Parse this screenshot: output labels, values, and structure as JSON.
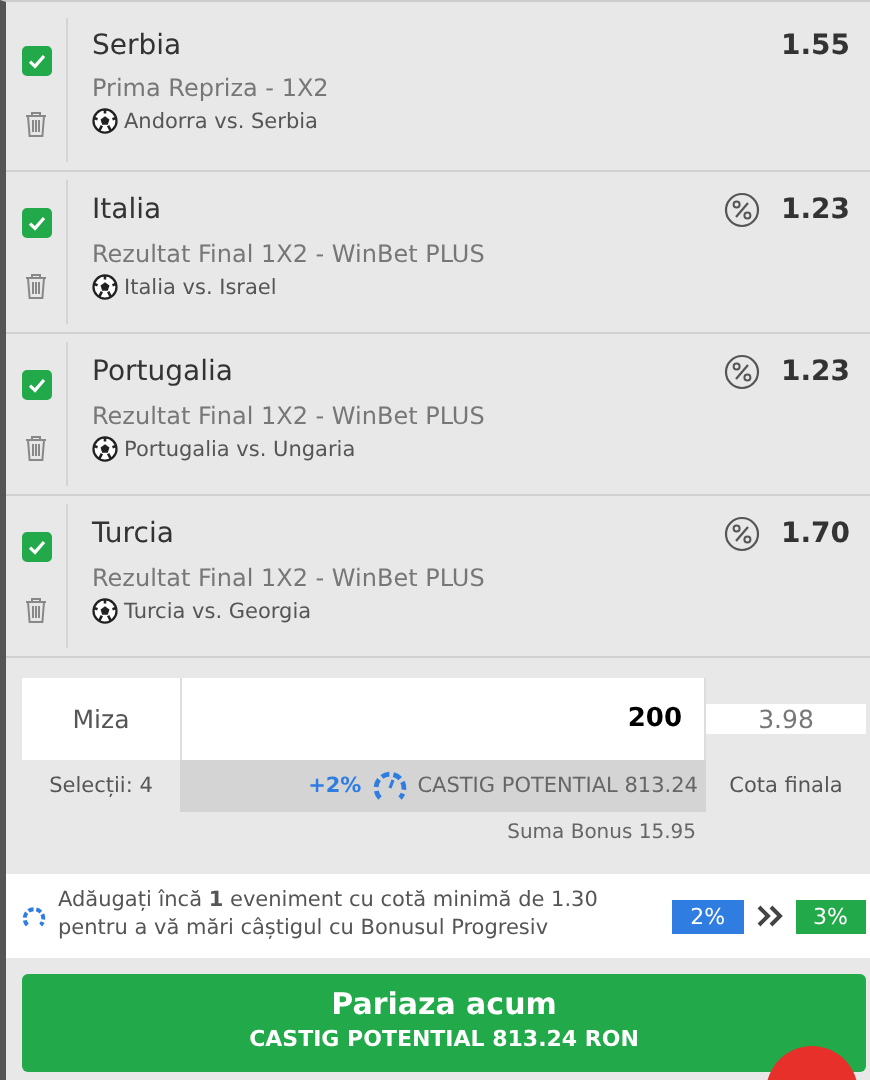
{
  "bets": [
    {
      "checked": true,
      "team": "Serbia",
      "market": "Prima Repriza - 1X2",
      "match": "Andorra vs. Serbia",
      "boost": false,
      "odds": "1.55"
    },
    {
      "checked": true,
      "team": "Italia",
      "market": "Rezultat Final 1X2 - WinBet PLUS",
      "match": "Italia vs. Israel",
      "boost": true,
      "odds": "1.23"
    },
    {
      "checked": true,
      "team": "Portugalia",
      "market": "Rezultat Final 1X2 - WinBet PLUS",
      "match": "Portugalia vs. Ungaria",
      "boost": true,
      "odds": "1.23"
    },
    {
      "checked": true,
      "team": "Turcia",
      "market": "Rezultat Final 1X2 - WinBet PLUS",
      "match": "Turcia vs. Georgia",
      "boost": true,
      "odds": "1.70"
    }
  ],
  "stake": {
    "label": "Miza",
    "value": "200",
    "total_odds": "3.98",
    "selections": "Selecții: 4",
    "boost_percent": "+2%",
    "potential": "CASTIG POTENTIAL 813.24",
    "odds_label": "Cota finala",
    "bonus": "Suma Bonus 15.95"
  },
  "progress_bonus": {
    "message": "Adăugați încă **1** eveniment cu cotă minimă de 1.30 pentru a vă mări câștigul cu Bonusul Progresiv",
    "current": "2%",
    "next": "3%"
  },
  "place_button": {
    "label": "Pariaza acum",
    "subtitle": "CASTIG POTENTIAL  813.24 RON"
  }
}
